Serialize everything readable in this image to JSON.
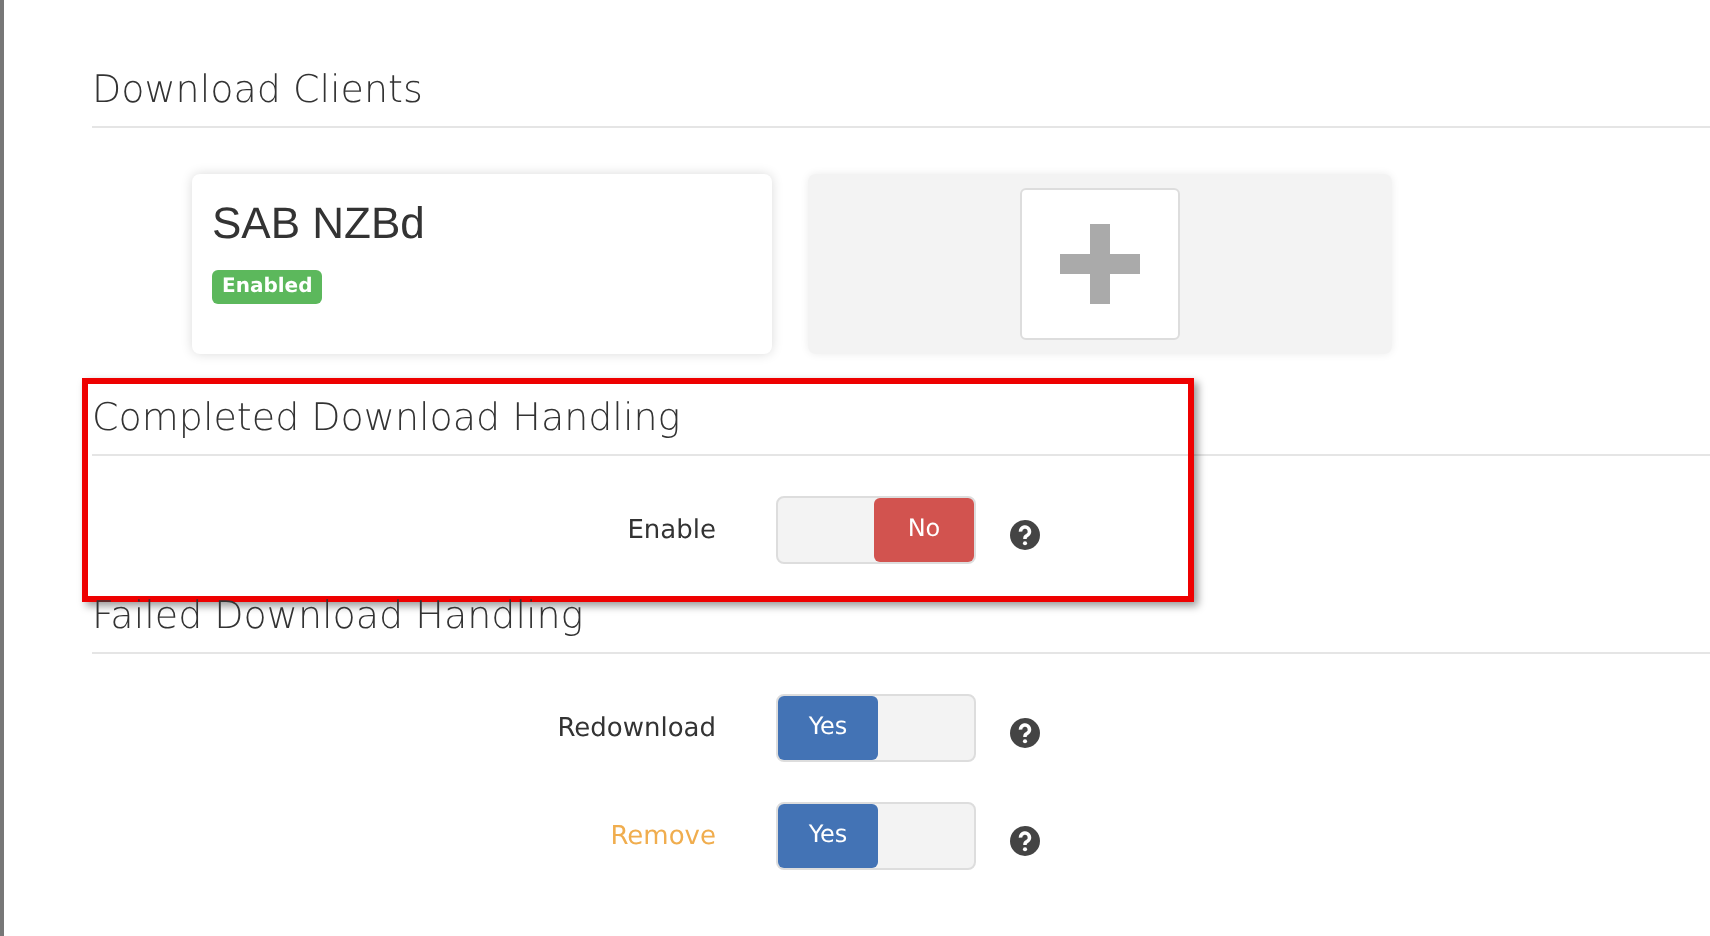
{
  "sections": [
    {
      "title": "Download Clients",
      "clients": [
        {
          "name": "SAB NZBd",
          "status": "Enabled",
          "enabled": true
        }
      ],
      "add_button": true
    },
    {
      "title": "Completed Download Handling",
      "highlighted": true,
      "settings": [
        {
          "label": "Enable",
          "warning": false,
          "on": false,
          "value": "No"
        }
      ]
    },
    {
      "title": "Failed Download Handling",
      "settings": [
        {
          "label": "Redownload",
          "warning": false,
          "on": true,
          "value": "Yes"
        },
        {
          "label": "Remove",
          "warning": true,
          "on": true,
          "value": "Yes"
        }
      ]
    }
  ]
}
